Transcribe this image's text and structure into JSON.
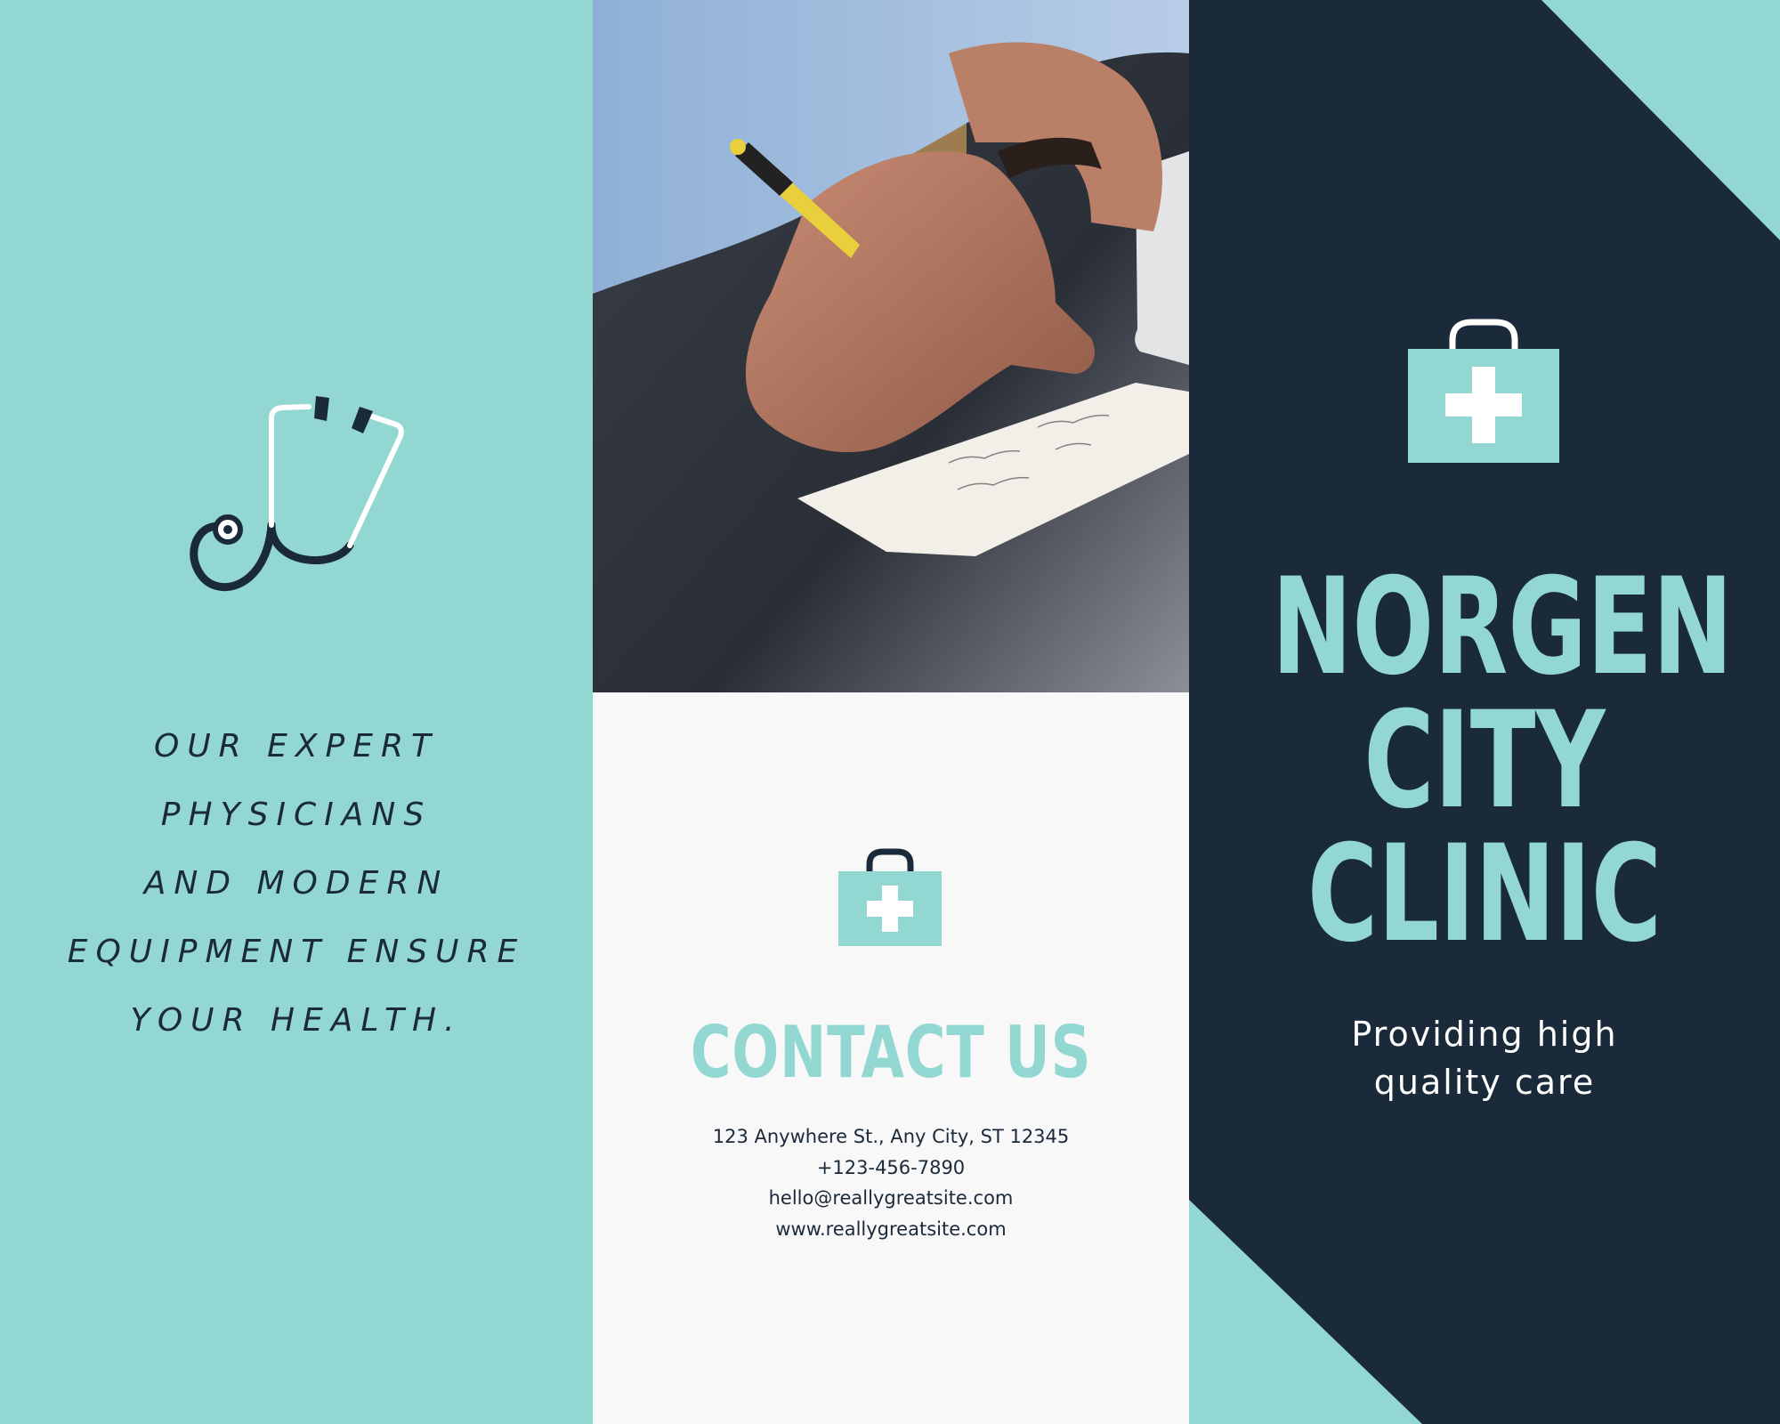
{
  "brochure": {
    "left_panel": {
      "icon": "stethoscope-icon",
      "tagline_lines": [
        "OUR EXPERT",
        "PHYSICIANS",
        "AND MODERN",
        "EQUIPMENT ENSURE",
        "YOUR HEALTH."
      ]
    },
    "middle_panel": {
      "photo": "photo of hand writing a note with a yellow pen",
      "icon": "medical-kit-icon",
      "contact_title": "CONTACT US",
      "contact_lines": [
        "123 Anywhere St., Any City, ST 12345",
        "+123-456-7890",
        "hello@reallygreatsite.com",
        "www.reallygreatsite.com"
      ]
    },
    "right_panel": {
      "icon": "medical-kit-icon",
      "clinic_name_lines": [
        "NORGEN",
        "CITY",
        "CLINIC"
      ],
      "subtitle_lines": [
        "Providing high",
        "quality care"
      ]
    }
  },
  "colors": {
    "mint": "#93d7d3",
    "navy": "#1b2a3a",
    "offwhite": "#f8f8f8",
    "white": "#ffffff"
  }
}
